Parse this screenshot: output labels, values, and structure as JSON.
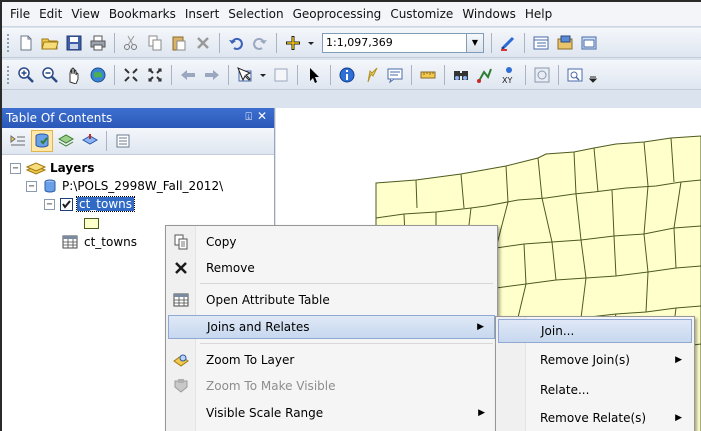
{
  "menubar": {
    "items": [
      "File",
      "Edit",
      "View",
      "Bookmarks",
      "Insert",
      "Selection",
      "Geoprocessing",
      "Customize",
      "Windows",
      "Help"
    ]
  },
  "toolbar": {
    "scale_value": "1:1,097,369"
  },
  "toc": {
    "title": "Table Of Contents",
    "pin_glyph": "⍗",
    "close_glyph": "✕",
    "tree": {
      "root_label": "Layers",
      "workspace_label": "P:\\POLS_2998W_Fall_2012\\",
      "layer_label": "ct_towns",
      "table_label": "ct_towns"
    }
  },
  "context_menu": {
    "items": [
      {
        "label": "Copy",
        "icon": "copy-icon"
      },
      {
        "label": "Remove",
        "icon": "remove-icon"
      },
      {
        "label": "Open Attribute Table",
        "icon": "table-icon"
      },
      {
        "label": "Joins and Relates",
        "icon": "",
        "submenu": true
      },
      {
        "label": "Zoom To Layer",
        "icon": "zoom-to-layer-icon"
      },
      {
        "label": "Zoom To Make Visible",
        "icon": "zoom-visible-icon",
        "disabled": true
      },
      {
        "label": "Visible Scale Range",
        "icon": "",
        "submenu": true
      }
    ]
  },
  "sub_menu": {
    "items": [
      {
        "label": "Join..."
      },
      {
        "label": "Remove Join(s)",
        "submenu": true
      },
      {
        "label": "Relate..."
      },
      {
        "label": "Remove Relate(s)",
        "submenu": true
      }
    ]
  },
  "colors": {
    "selection": "#316ac5",
    "map_polygon_fill": "#ffffcc",
    "map_polygon_stroke": "#4d5a1e",
    "toc_title_bar": "#2a58b8"
  }
}
